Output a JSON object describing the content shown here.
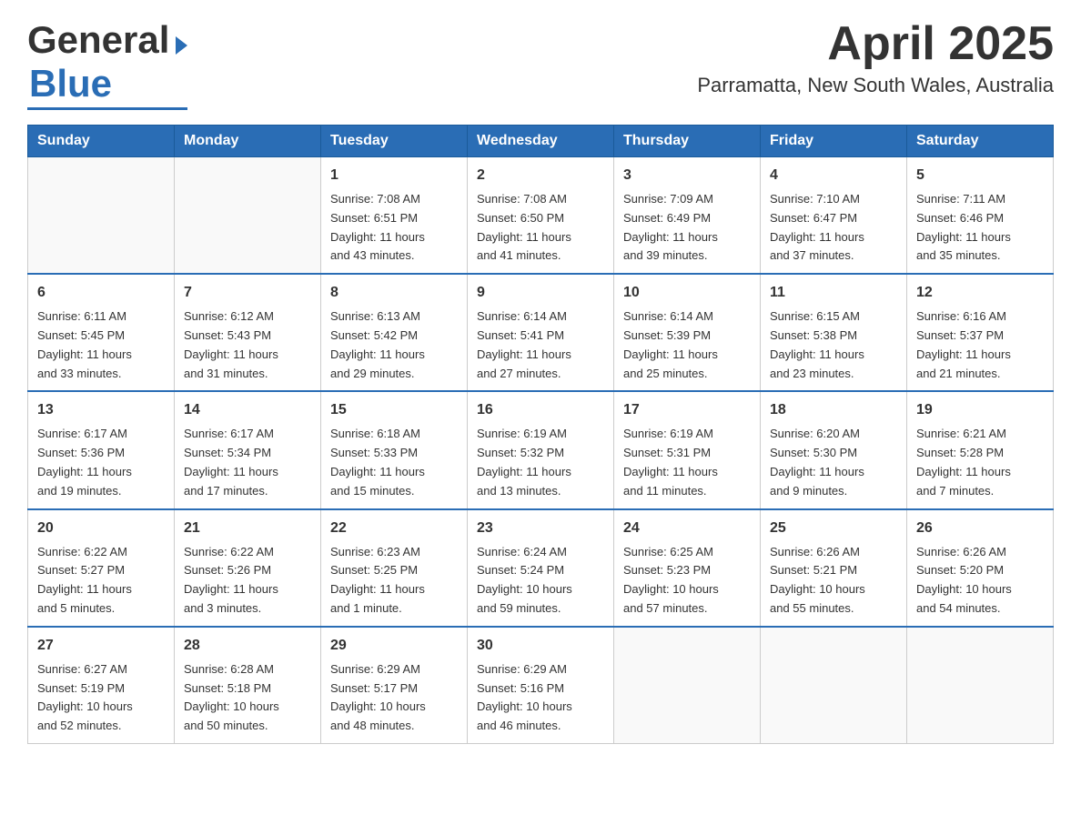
{
  "header": {
    "title": "April 2025",
    "subtitle": "Parramatta, New South Wales, Australia",
    "logo_general": "General",
    "logo_blue": "Blue"
  },
  "calendar": {
    "days_of_week": [
      "Sunday",
      "Monday",
      "Tuesday",
      "Wednesday",
      "Thursday",
      "Friday",
      "Saturday"
    ],
    "weeks": [
      [
        {
          "day": "",
          "info": ""
        },
        {
          "day": "",
          "info": ""
        },
        {
          "day": "1",
          "info": "Sunrise: 7:08 AM\nSunset: 6:51 PM\nDaylight: 11 hours\nand 43 minutes."
        },
        {
          "day": "2",
          "info": "Sunrise: 7:08 AM\nSunset: 6:50 PM\nDaylight: 11 hours\nand 41 minutes."
        },
        {
          "day": "3",
          "info": "Sunrise: 7:09 AM\nSunset: 6:49 PM\nDaylight: 11 hours\nand 39 minutes."
        },
        {
          "day": "4",
          "info": "Sunrise: 7:10 AM\nSunset: 6:47 PM\nDaylight: 11 hours\nand 37 minutes."
        },
        {
          "day": "5",
          "info": "Sunrise: 7:11 AM\nSunset: 6:46 PM\nDaylight: 11 hours\nand 35 minutes."
        }
      ],
      [
        {
          "day": "6",
          "info": "Sunrise: 6:11 AM\nSunset: 5:45 PM\nDaylight: 11 hours\nand 33 minutes."
        },
        {
          "day": "7",
          "info": "Sunrise: 6:12 AM\nSunset: 5:43 PM\nDaylight: 11 hours\nand 31 minutes."
        },
        {
          "day": "8",
          "info": "Sunrise: 6:13 AM\nSunset: 5:42 PM\nDaylight: 11 hours\nand 29 minutes."
        },
        {
          "day": "9",
          "info": "Sunrise: 6:14 AM\nSunset: 5:41 PM\nDaylight: 11 hours\nand 27 minutes."
        },
        {
          "day": "10",
          "info": "Sunrise: 6:14 AM\nSunset: 5:39 PM\nDaylight: 11 hours\nand 25 minutes."
        },
        {
          "day": "11",
          "info": "Sunrise: 6:15 AM\nSunset: 5:38 PM\nDaylight: 11 hours\nand 23 minutes."
        },
        {
          "day": "12",
          "info": "Sunrise: 6:16 AM\nSunset: 5:37 PM\nDaylight: 11 hours\nand 21 minutes."
        }
      ],
      [
        {
          "day": "13",
          "info": "Sunrise: 6:17 AM\nSunset: 5:36 PM\nDaylight: 11 hours\nand 19 minutes."
        },
        {
          "day": "14",
          "info": "Sunrise: 6:17 AM\nSunset: 5:34 PM\nDaylight: 11 hours\nand 17 minutes."
        },
        {
          "day": "15",
          "info": "Sunrise: 6:18 AM\nSunset: 5:33 PM\nDaylight: 11 hours\nand 15 minutes."
        },
        {
          "day": "16",
          "info": "Sunrise: 6:19 AM\nSunset: 5:32 PM\nDaylight: 11 hours\nand 13 minutes."
        },
        {
          "day": "17",
          "info": "Sunrise: 6:19 AM\nSunset: 5:31 PM\nDaylight: 11 hours\nand 11 minutes."
        },
        {
          "day": "18",
          "info": "Sunrise: 6:20 AM\nSunset: 5:30 PM\nDaylight: 11 hours\nand 9 minutes."
        },
        {
          "day": "19",
          "info": "Sunrise: 6:21 AM\nSunset: 5:28 PM\nDaylight: 11 hours\nand 7 minutes."
        }
      ],
      [
        {
          "day": "20",
          "info": "Sunrise: 6:22 AM\nSunset: 5:27 PM\nDaylight: 11 hours\nand 5 minutes."
        },
        {
          "day": "21",
          "info": "Sunrise: 6:22 AM\nSunset: 5:26 PM\nDaylight: 11 hours\nand 3 minutes."
        },
        {
          "day": "22",
          "info": "Sunrise: 6:23 AM\nSunset: 5:25 PM\nDaylight: 11 hours\nand 1 minute."
        },
        {
          "day": "23",
          "info": "Sunrise: 6:24 AM\nSunset: 5:24 PM\nDaylight: 10 hours\nand 59 minutes."
        },
        {
          "day": "24",
          "info": "Sunrise: 6:25 AM\nSunset: 5:23 PM\nDaylight: 10 hours\nand 57 minutes."
        },
        {
          "day": "25",
          "info": "Sunrise: 6:26 AM\nSunset: 5:21 PM\nDaylight: 10 hours\nand 55 minutes."
        },
        {
          "day": "26",
          "info": "Sunrise: 6:26 AM\nSunset: 5:20 PM\nDaylight: 10 hours\nand 54 minutes."
        }
      ],
      [
        {
          "day": "27",
          "info": "Sunrise: 6:27 AM\nSunset: 5:19 PM\nDaylight: 10 hours\nand 52 minutes."
        },
        {
          "day": "28",
          "info": "Sunrise: 6:28 AM\nSunset: 5:18 PM\nDaylight: 10 hours\nand 50 minutes."
        },
        {
          "day": "29",
          "info": "Sunrise: 6:29 AM\nSunset: 5:17 PM\nDaylight: 10 hours\nand 48 minutes."
        },
        {
          "day": "30",
          "info": "Sunrise: 6:29 AM\nSunset: 5:16 PM\nDaylight: 10 hours\nand 46 minutes."
        },
        {
          "day": "",
          "info": ""
        },
        {
          "day": "",
          "info": ""
        },
        {
          "day": "",
          "info": ""
        }
      ]
    ]
  }
}
